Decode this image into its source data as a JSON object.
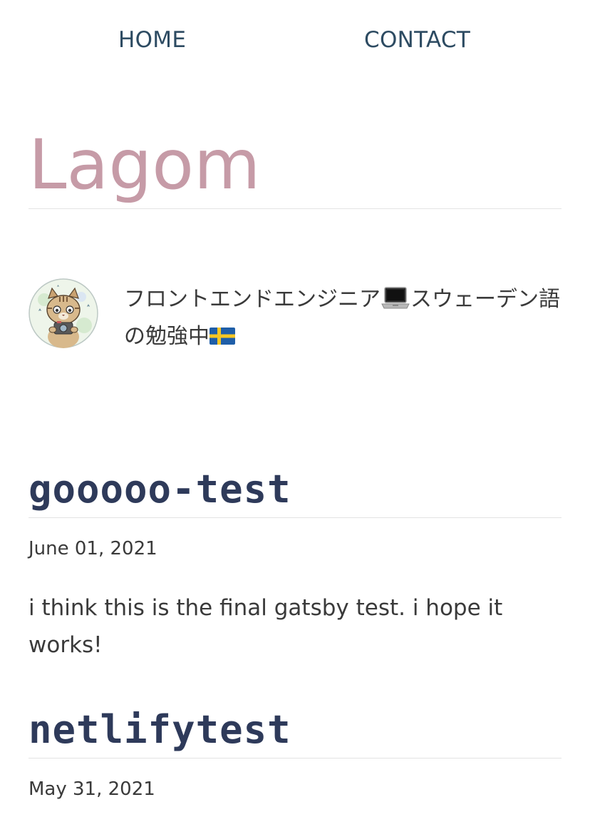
{
  "nav": {
    "home_label": "HOME",
    "contact_label": "CONTACT"
  },
  "site": {
    "title": "Lagom",
    "title_color": "#c69ba7"
  },
  "bio": {
    "text_part1": "フロントエンドエンジニア",
    "text_part2": "スウェーデン語の勉強中",
    "icons": [
      "cat-avatar-icon",
      "laptop-icon",
      "sweden-flag-icon"
    ]
  },
  "posts": [
    {
      "title": "gooooo-test",
      "date": "June 01, 2021",
      "excerpt": "i think this is the final gatsby test. i hope it works!"
    },
    {
      "title": "netlifytest",
      "date": "May 31, 2021"
    }
  ],
  "colors": {
    "nav": "#2d4b62",
    "post_title": "#2e3a5a",
    "text": "#3a3a3a",
    "rule": "#e3e3e3"
  }
}
